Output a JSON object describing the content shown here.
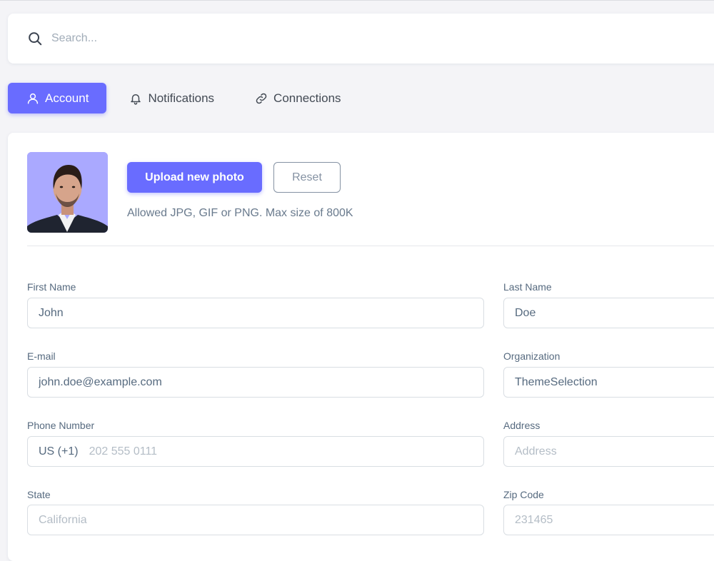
{
  "search": {
    "placeholder": "Search..."
  },
  "tabs": [
    {
      "label": "Account",
      "icon": "user-icon",
      "active": true
    },
    {
      "label": "Notifications",
      "icon": "bell-icon",
      "active": false
    },
    {
      "label": "Connections",
      "icon": "link-icon",
      "active": false
    }
  ],
  "profile": {
    "upload_label": "Upload new photo",
    "reset_label": "Reset",
    "hint": "Allowed JPG, GIF or PNG. Max size of 800K"
  },
  "form": {
    "first_name": {
      "label": "First Name",
      "value": "John"
    },
    "last_name": {
      "label": "Last Name",
      "value": "Doe"
    },
    "email": {
      "label": "E-mail",
      "value": "john.doe@example.com"
    },
    "organization": {
      "label": "Organization",
      "value": "ThemeSelection"
    },
    "phone": {
      "label": "Phone Number",
      "prefix": "US (+1)",
      "placeholder": "202 555 0111"
    },
    "address": {
      "label": "Address",
      "placeholder": "Address"
    },
    "state": {
      "label": "State",
      "placeholder": "California"
    },
    "zip": {
      "label": "Zip Code",
      "placeholder": "231465"
    }
  },
  "colors": {
    "primary": "#696cff",
    "avatar_bg": "#aaa9ff",
    "text": "#566a7f"
  }
}
